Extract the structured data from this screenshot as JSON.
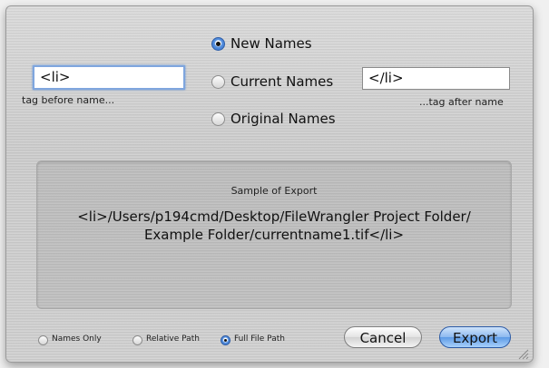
{
  "name_mode": {
    "options": [
      {
        "label": "New Names",
        "selected": true
      },
      {
        "label": "Current Names",
        "selected": false
      },
      {
        "label": "Original Names",
        "selected": false
      }
    ]
  },
  "tag_before": {
    "value": "<li>",
    "caption": "tag before name..."
  },
  "tag_after": {
    "value": "</li>",
    "caption": "...tag after name"
  },
  "sample": {
    "title": "Sample of Export",
    "line1": "<li>/Users/p194cmd/Desktop/FileWrangler Project Folder/",
    "line2": "Example Folder/currentname1.tif</li>"
  },
  "path_mode": {
    "options": [
      {
        "label": "Names Only",
        "selected": false
      },
      {
        "label": "Relative Path",
        "selected": false
      },
      {
        "label": "Full File Path",
        "selected": true
      }
    ]
  },
  "buttons": {
    "cancel": "Cancel",
    "export": "Export"
  },
  "colors": {
    "accent": "#2c69c8",
    "focus_ring": "#7fa6de"
  }
}
